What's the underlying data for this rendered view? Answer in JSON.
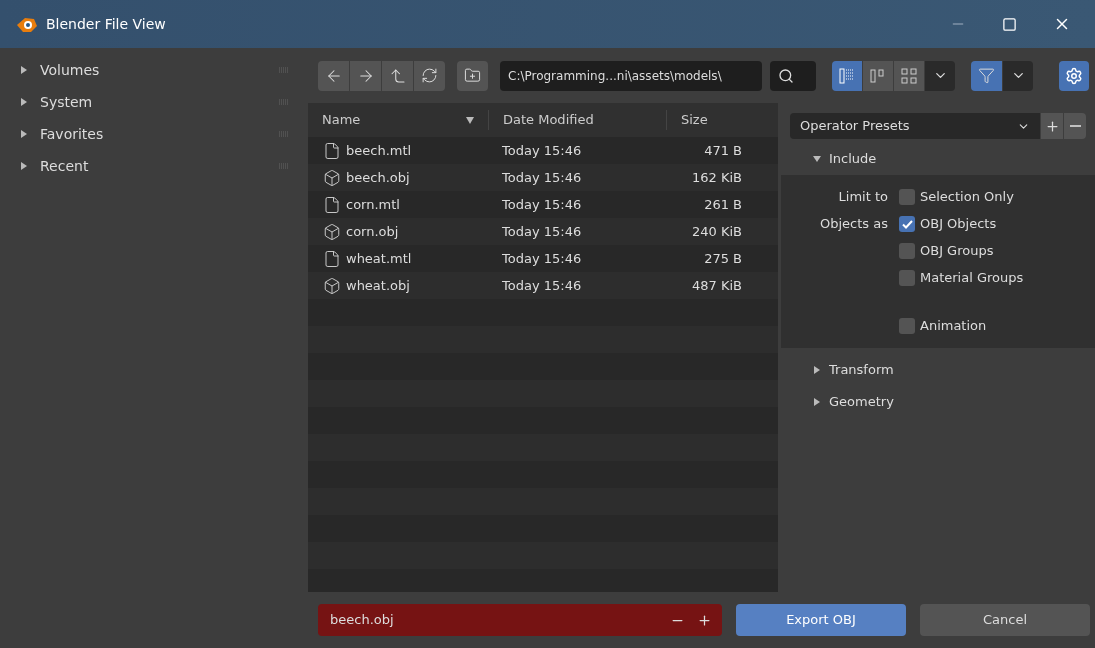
{
  "window": {
    "title": "Blender File View"
  },
  "sidebar": [
    {
      "label": "Volumes",
      "expanded": false
    },
    {
      "label": "System",
      "expanded": false
    },
    {
      "label": "Favorites",
      "expanded": false
    },
    {
      "label": "Recent",
      "expanded": false
    }
  ],
  "toolbar": {
    "path": "C:\\Programming...ni\\assets\\models\\",
    "view_modes": [
      {
        "kind": "list",
        "selected": true
      },
      {
        "kind": "columns",
        "selected": false
      },
      {
        "kind": "grid",
        "selected": false
      }
    ],
    "filter_on": true,
    "settings_on": true
  },
  "table": {
    "columns": [
      {
        "label": "Name",
        "sorted": true
      },
      {
        "label": "Date Modified",
        "sorted": false
      },
      {
        "label": "Size",
        "sorted": false
      }
    ],
    "rows": [
      {
        "kind": "text",
        "name": "beech.mtl",
        "date": "Today 15:46",
        "size": "471 B"
      },
      {
        "kind": "mesh",
        "name": "beech.obj",
        "date": "Today 15:46",
        "size": "162 KiB"
      },
      {
        "kind": "text",
        "name": "corn.mtl",
        "date": "Today 15:46",
        "size": "261 B"
      },
      {
        "kind": "mesh",
        "name": "corn.obj",
        "date": "Today 15:46",
        "size": "240 KiB"
      },
      {
        "kind": "text",
        "name": "wheat.mtl",
        "date": "Today 15:46",
        "size": "275 B"
      },
      {
        "kind": "mesh",
        "name": "wheat.obj",
        "date": "Today 15:46",
        "size": "487 KiB"
      }
    ]
  },
  "presets": {
    "label": "Operator Presets"
  },
  "panels": [
    {
      "title": "Include",
      "expanded": true,
      "groups": [
        [
          {
            "label": "Limit to",
            "text": "Selection Only",
            "checked": false
          },
          {
            "label": "Objects as",
            "text": "OBJ Objects",
            "checked": true
          },
          {
            "text": "OBJ Groups",
            "checked": false
          },
          {
            "text": "Material Groups",
            "checked": false
          }
        ],
        [
          {
            "text": "Animation",
            "checked": false
          }
        ]
      ]
    },
    {
      "title": "Transform",
      "expanded": false
    },
    {
      "title": "Geometry",
      "expanded": false
    }
  ],
  "footer": {
    "filename": "beech.obj",
    "filename_invalid": true,
    "confirm": "Export OBJ",
    "cancel": "Cancel"
  }
}
